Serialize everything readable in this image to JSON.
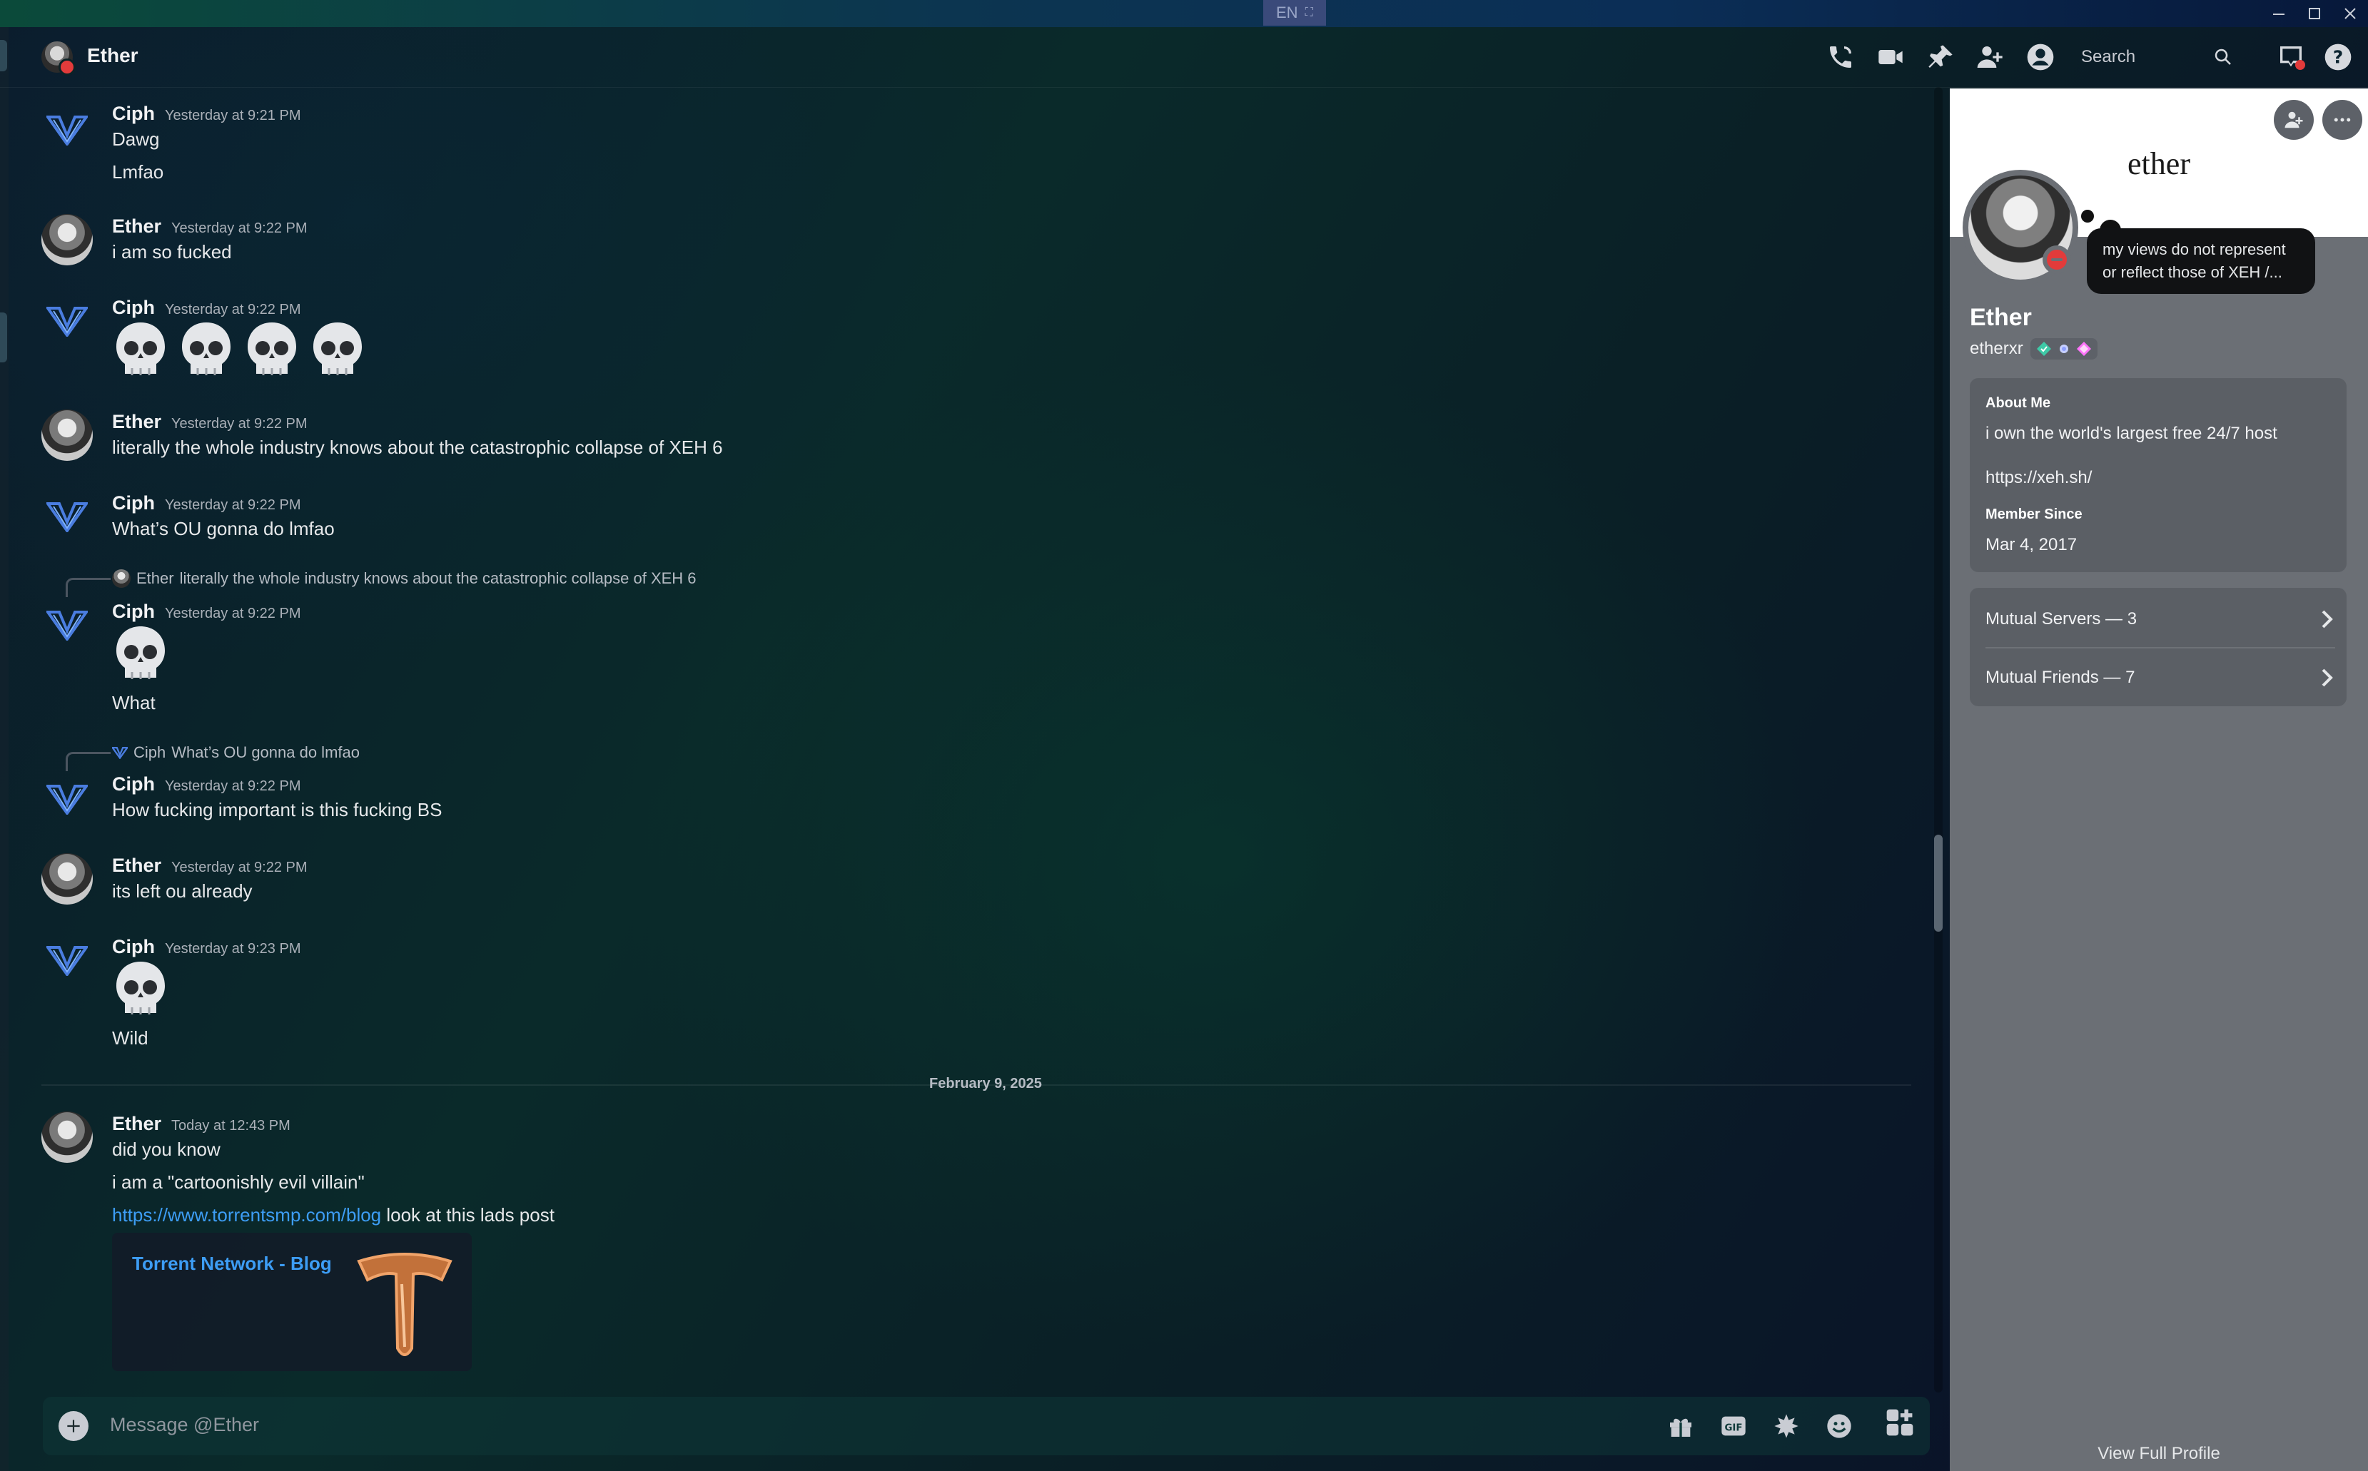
{
  "window": {
    "lang_chip": "EN",
    "controls": [
      "minimize",
      "maximize",
      "close"
    ]
  },
  "header": {
    "title": "Ether",
    "icons": [
      "phone-icon",
      "video-icon",
      "pin-icon",
      "add-friend-icon",
      "profile-toggle-icon"
    ],
    "search_placeholder": "Search",
    "right_icons": [
      "inbox-icon",
      "help-icon"
    ]
  },
  "messages": [
    {
      "author": "Ciph",
      "timestamp": "Yesterday at 9:21 PM",
      "lines": [
        "Dawg",
        "Lmfao"
      ]
    },
    {
      "author": "Ether",
      "timestamp": "Yesterday at 9:22 PM",
      "lines": [
        "i am so fucked"
      ]
    },
    {
      "author": "Ciph",
      "timestamp": "Yesterday at 9:22 PM",
      "emoji": [
        "skull",
        "skull",
        "skull",
        "skull"
      ]
    },
    {
      "author": "Ether",
      "timestamp": "Yesterday at 9:22 PM",
      "lines": [
        "literally the whole industry knows about the catastrophic collapse of XEH 6"
      ]
    },
    {
      "author": "Ciph",
      "timestamp": "Yesterday at 9:22 PM",
      "lines": [
        "What’s OU gonna do lmfao"
      ]
    },
    {
      "author": "Ciph",
      "timestamp": "Yesterday at 9:22 PM",
      "reply": {
        "author": "Ether",
        "text": "literally the whole industry knows about the catastrophic collapse of XEH 6"
      },
      "emoji": [
        "skull"
      ],
      "lines": [
        "What"
      ]
    },
    {
      "author": "Ciph",
      "timestamp": "Yesterday at 9:22 PM",
      "reply": {
        "author": "Ciph",
        "text": "What’s OU gonna do lmfao"
      },
      "lines": [
        "How fucking important is this fucking BS"
      ]
    },
    {
      "author": "Ether",
      "timestamp": "Yesterday at 9:22 PM",
      "lines": [
        "its left ou already"
      ]
    },
    {
      "author": "Ciph",
      "timestamp": "Yesterday at 9:23 PM",
      "emoji": [
        "skull"
      ],
      "lines": [
        "Wild"
      ]
    },
    {
      "author": "Ether",
      "timestamp": "Today at 12:43 PM",
      "lines": [
        "did you know",
        "i am a \"cartoonishly evil villain\""
      ],
      "link": "https://www.torrentsmp.com/blog",
      "link_suffix": " look at this lads post",
      "embed_title": "Torrent Network - Blog"
    }
  ],
  "date_divider": "February 9, 2025",
  "composer": {
    "placeholder": "Message @Ether",
    "icons": [
      "gift-icon",
      "gif-icon",
      "sticker-icon",
      "emoji-icon",
      "apps-icon"
    ]
  },
  "profile": {
    "banner_text": "ether",
    "status_bubble": "my views do not represent or reflect those of XEH /...",
    "display_name": "Ether",
    "username": "etherxr",
    "about_label": "About Me",
    "about_text": "i own the world's largest free 24/7 host",
    "about_link": "https://xeh.sh/",
    "member_since_label": "Member Since",
    "member_since": "Mar 4, 2017",
    "mutual_servers": "Mutual Servers — 3",
    "mutual_friends": "Mutual Friends — 7",
    "view_full": "View Full Profile"
  }
}
